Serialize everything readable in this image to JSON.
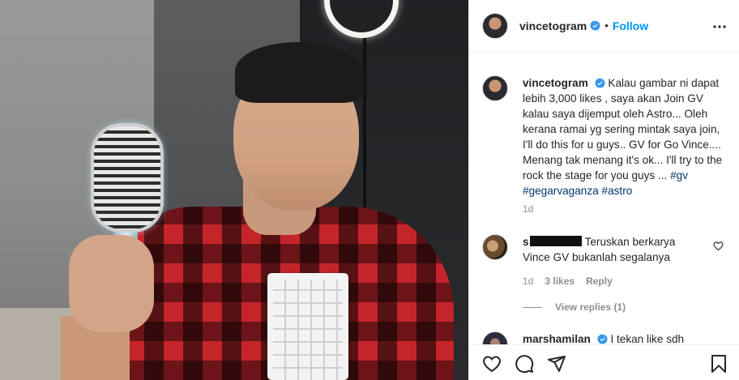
{
  "header": {
    "username": "vincetogram",
    "separator": "•",
    "follow_label": "Follow"
  },
  "caption": {
    "username": "vincetogram",
    "text": "Kalau gambar ni dapat lebih 3,000 likes , saya akan Join GV kalau saya dijemput oleh Astro... Oleh kerana ramai yg sering mintak saya join, I'll do this for u guys.. GV for Go Vince.... Menang tak menang it's ok... I'll try to the rock the stage for you guys ...",
    "hashtags": [
      "#gv",
      "#gegarvaganza",
      "#astro"
    ],
    "time": "1d"
  },
  "comments": [
    {
      "username_visible": "s",
      "text": "Teruskan berkarya Vince GV bukanlah segalanya",
      "time": "1d",
      "likes": "3 likes",
      "reply_label": "Reply",
      "view_replies": "View replies (1)"
    },
    {
      "username": "marshamilan",
      "text": "I tekan like sdh"
    }
  ],
  "icons": {
    "verified": "verified-badge-icon",
    "more": "more-options-icon",
    "like": "heart-icon",
    "comment": "comment-bubble-icon",
    "share": "paper-plane-icon",
    "save": "bookmark-icon"
  },
  "colors": {
    "accent": "#0095f6",
    "hashtag": "#00376b",
    "muted": "#8e8e8e",
    "verified": "#3897f0"
  }
}
